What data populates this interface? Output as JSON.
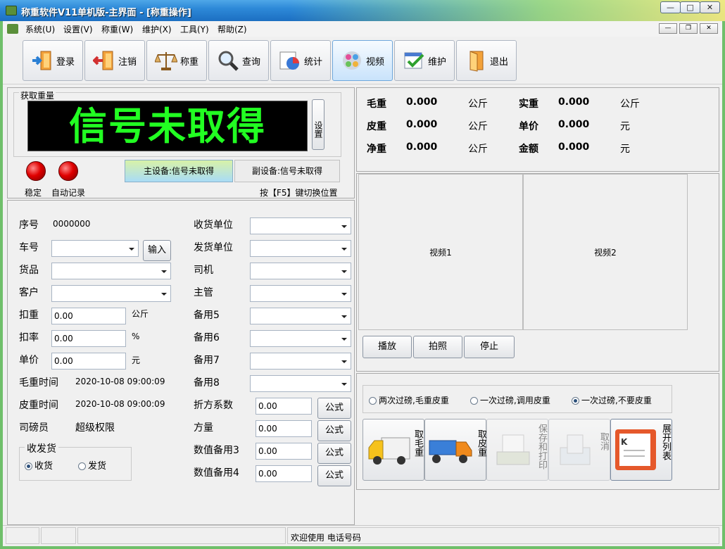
{
  "window": {
    "title": "称重软件V11单机版-主界面 - [称重操作]"
  },
  "menu": [
    "系统(U)",
    "设置(V)",
    "称重(W)",
    "维护(X)",
    "工具(Y)",
    "帮助(Z)"
  ],
  "toolbar": [
    "登录",
    "注销",
    "称重",
    "查询",
    "统计",
    "视频",
    "维护",
    "退出"
  ],
  "weigh_panel": {
    "group_title": "获取重量",
    "led_text": "信号未取得",
    "set_button": "设置",
    "stable_label": "稳定",
    "auto_record_label": "自动记录",
    "main_device": "主设备:信号未取得",
    "sub_device": "副设备:信号未取得",
    "switch_hint": "按【F5】键切换位置"
  },
  "summary": {
    "rows": [
      {
        "l1": "毛重",
        "v1": "0.000",
        "u1": "公斤",
        "l2": "实重",
        "v2": "0.000",
        "u2": "公斤"
      },
      {
        "l1": "皮重",
        "v1": "0.000",
        "u1": "公斤",
        "l2": "单价",
        "v2": "0.000",
        "u2": "元"
      },
      {
        "l1": "净重",
        "v1": "0.000",
        "u1": "公斤",
        "l2": "金额",
        "v2": "0.000",
        "u2": "元"
      }
    ]
  },
  "form": {
    "serial_label": "序号",
    "serial_value": "0000000",
    "plate_label": "车号",
    "input_button": "输入",
    "goods_label": "货品",
    "customer_label": "客户",
    "deduct_label": "扣重",
    "deduct_value": "0.00",
    "deduct_unit": "公斤",
    "rate_label": "扣率",
    "rate_value": "0.00",
    "rate_unit": "%",
    "price_label": "单价",
    "price_value": "0.00",
    "price_unit": "元",
    "gross_time_label": "毛重时间",
    "gross_time_value": "2020-10-08 09:00:09",
    "tare_time_label": "皮重时间",
    "tare_time_value": "2020-10-08 09:00:09",
    "operator_label": "司磅员",
    "operator_value": "超级权限",
    "direction_title": "收发货",
    "receive": "收货",
    "send": "发货",
    "receiver_label": "收货单位",
    "sender_label": "发货单位",
    "driver_label": "司机",
    "supervisor_label": "主管",
    "spare5_label": "备用5",
    "spare6_label": "备用6",
    "spare7_label": "备用7",
    "spare8_label": "备用8",
    "factor_label": "折方系数",
    "factor_value": "0.00",
    "volume_label": "方量",
    "volume_value": "0.00",
    "num3_label": "数值备用3",
    "num3_value": "0.00",
    "num4_label": "数值备用4",
    "num4_value": "0.00",
    "formula_button": "公式"
  },
  "video": {
    "video1": "视频1",
    "video2": "视频2",
    "play": "播放",
    "snapshot": "拍照",
    "stop": "停止"
  },
  "mode": {
    "opt1": "两次过磅,毛重皮重",
    "opt2": "一次过磅,调用皮重",
    "opt3": "一次过磅,不要皮重",
    "selected": "opt3"
  },
  "actions": {
    "gross": "取毛重",
    "tare": "取皮重",
    "save_print": "保存和打印",
    "cancel": "取消",
    "expand": "展开列表"
  },
  "status": {
    "text": "欢迎使用 电话号码"
  },
  "colors": {
    "led": "#22ff22",
    "title_bar": "#2d89d8",
    "light": "#e00000"
  }
}
